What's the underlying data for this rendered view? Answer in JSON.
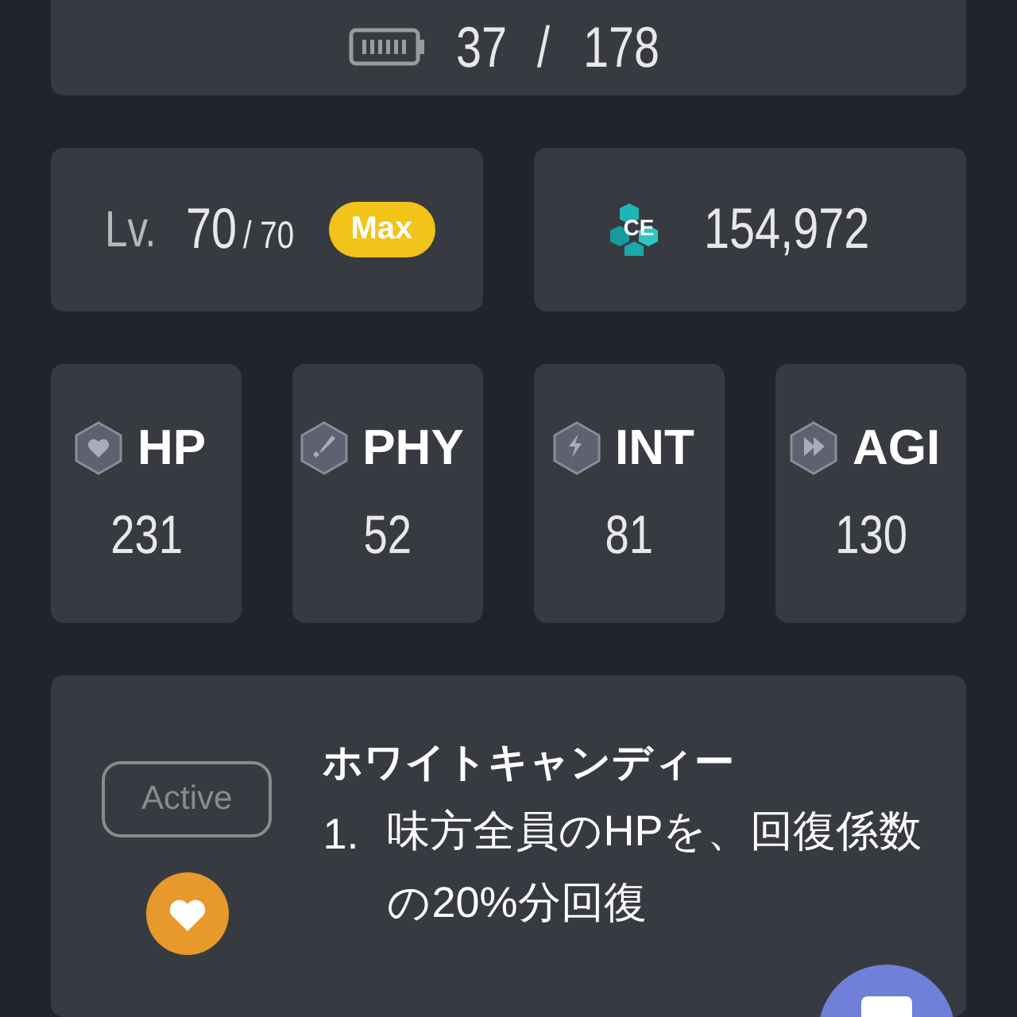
{
  "stamina": {
    "current": "37",
    "separator": "/",
    "max": "178"
  },
  "level": {
    "label": "Lv.",
    "current": "70",
    "max": "/ 70",
    "badge": "Max"
  },
  "combat_effectiveness": {
    "icon_text": "CE",
    "value": "154,972"
  },
  "stats": [
    {
      "kind": "heart",
      "label": "HP",
      "value": "231"
    },
    {
      "kind": "sword",
      "label": "PHY",
      "value": "52"
    },
    {
      "kind": "bolt",
      "label": "INT",
      "value": "81"
    },
    {
      "kind": "speed",
      "label": "AGI",
      "value": "130"
    }
  ],
  "skill": {
    "type": "Active",
    "name": "ホワイトキャンディー",
    "effects": [
      {
        "number": "1.",
        "text": "味方全員のHPを、回復係数の20%分回復"
      }
    ]
  }
}
